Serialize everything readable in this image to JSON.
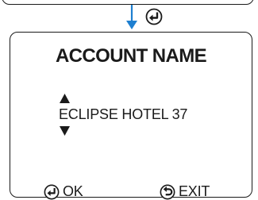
{
  "screen": {
    "title": "ACCOUNT NAME",
    "value": "ECLIPSE HOTEL 37"
  },
  "actions": {
    "ok_label": "OK",
    "exit_label": "EXIT"
  },
  "icons": {
    "flow": "down-arrow-icon",
    "enter_key": "enter-key-icon",
    "scroll_up": "scroll-up-icon",
    "scroll_down": "scroll-down-icon",
    "ok": "enter-key-icon",
    "exit": "back-key-icon"
  },
  "colors": {
    "flow_arrow": "#1e7fd0",
    "ink": "#1a1a1a",
    "background": "#ffffff"
  }
}
